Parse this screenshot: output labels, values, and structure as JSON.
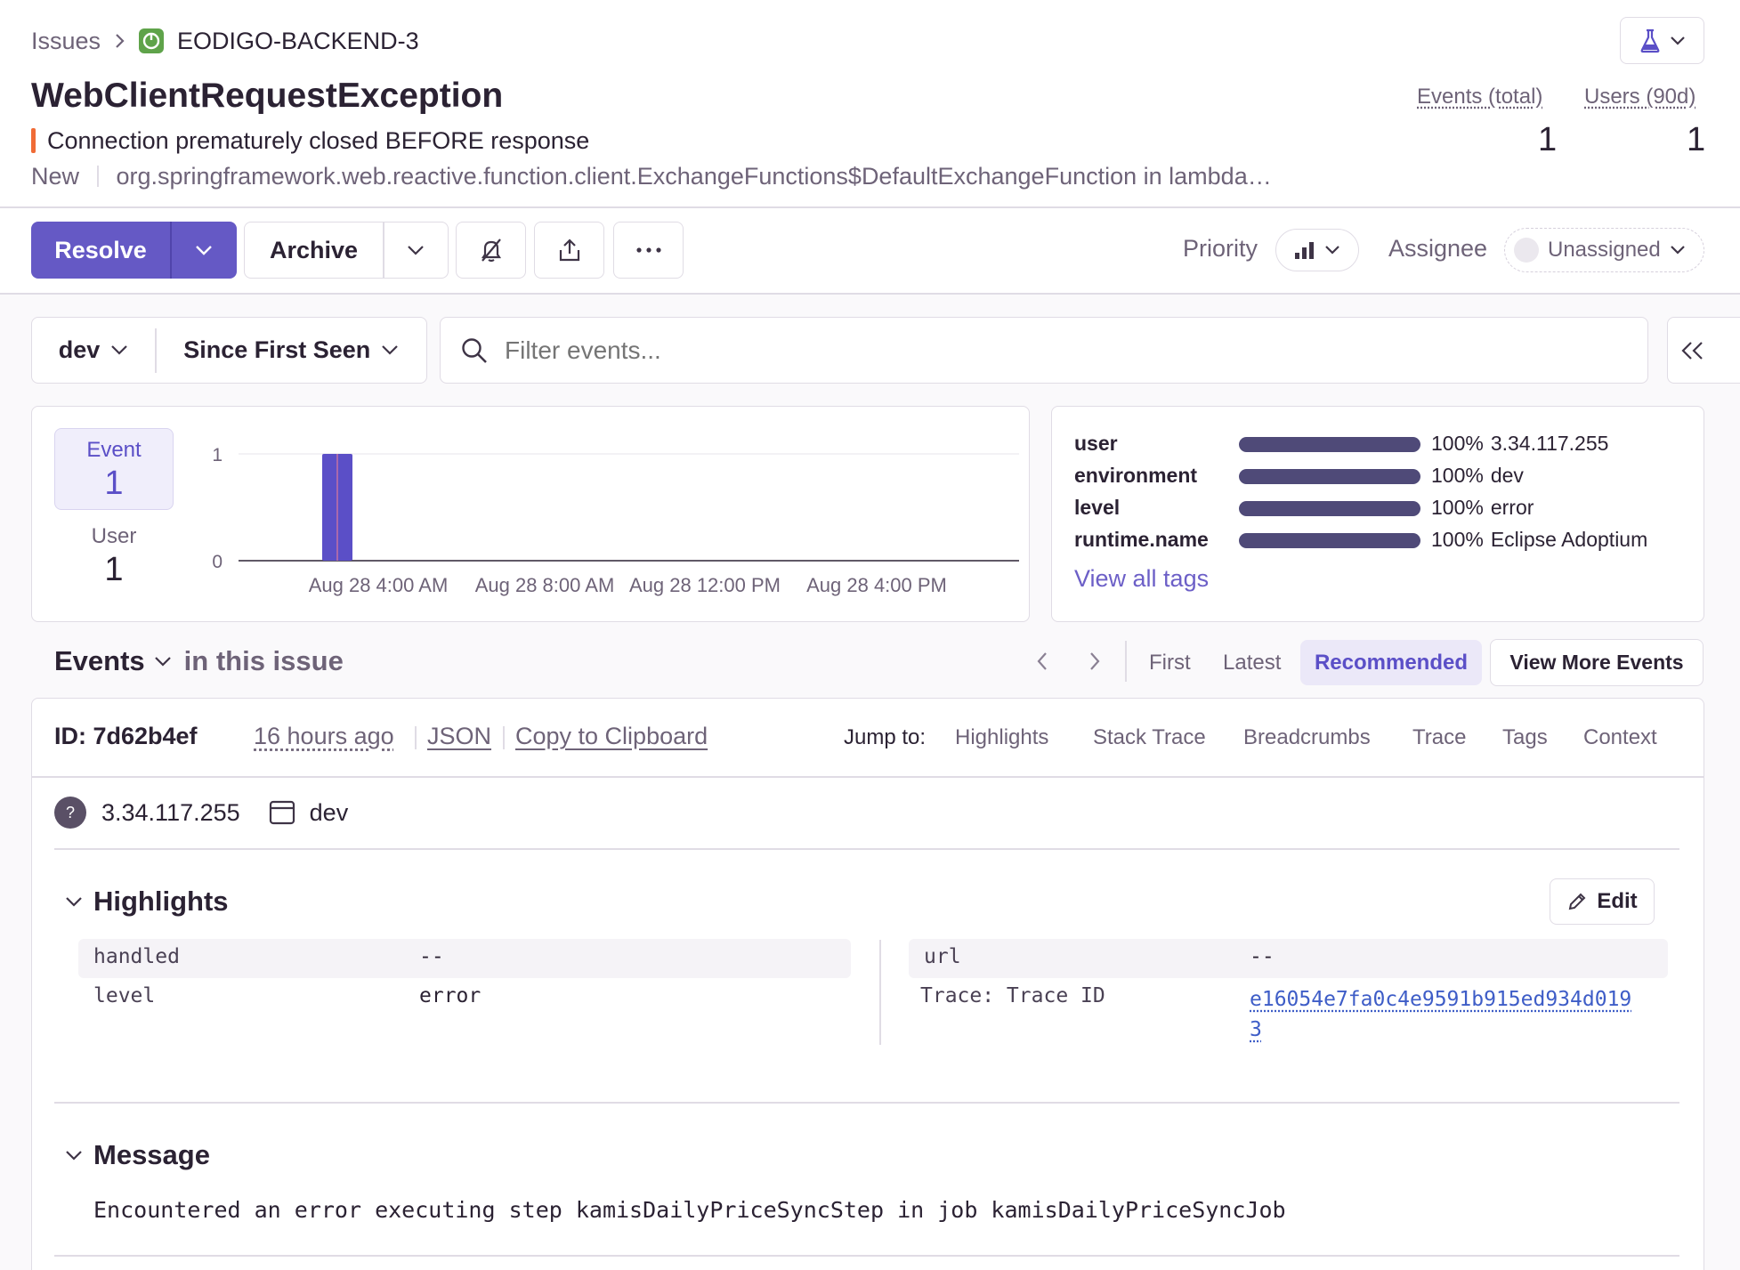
{
  "breadcrumb": {
    "issues": "Issues",
    "project": "EODIGO-BACKEND-3"
  },
  "issue": {
    "title": "WebClientRequestException",
    "message": "Connection prematurely closed BEFORE response",
    "status": "New",
    "culprit": "org.springframework.web.reactive.function.client.ExchangeFunctions$DefaultExchangeFunction in lambda…"
  },
  "stats": {
    "events_label": "Events (total)",
    "events_value": "1",
    "users_label": "Users (90d)",
    "users_value": "1"
  },
  "actions": {
    "resolve": "Resolve",
    "archive": "Archive",
    "priority_label": "Priority",
    "assignee_label": "Assignee",
    "assignee_value": "Unassigned"
  },
  "filters": {
    "environment": "dev",
    "period": "Since First Seen",
    "search_placeholder": "Filter events..."
  },
  "summary": {
    "event_label": "Event",
    "event_value": "1",
    "user_label": "User",
    "user_value": "1"
  },
  "chart_data": {
    "type": "bar",
    "y_ticks": [
      "1",
      "0"
    ],
    "ylim": [
      0,
      1
    ],
    "x_tick_labels": [
      "Aug 28 4:00 AM",
      "Aug 28 8:00 AM",
      "Aug 28 12:00 PM",
      "Aug 28 4:00 PM"
    ],
    "series": [
      {
        "values": [
          1
        ]
      }
    ],
    "bar_color": "#5b4fc7"
  },
  "tags": {
    "items": [
      {
        "key": "user",
        "percent": "100%",
        "value": "3.34.117.255"
      },
      {
        "key": "environment",
        "percent": "100%",
        "value": "dev"
      },
      {
        "key": "level",
        "percent": "100%",
        "value": "error"
      },
      {
        "key": "runtime.name",
        "percent": "100%",
        "value": "Eclipse Adoptium"
      }
    ],
    "view_all": "View all tags"
  },
  "events_header": {
    "title": "Events",
    "subtitle": "in this issue",
    "first": "First",
    "latest": "Latest",
    "recommended": "Recommended",
    "view_more": "View More Events"
  },
  "event": {
    "id": "ID: 7d62b4ef",
    "age": "16 hours ago",
    "json": "JSON",
    "copy": "Copy to Clipboard",
    "jump_label": "Jump to:",
    "jump_items": [
      "Highlights",
      "Stack Trace",
      "Breadcrumbs",
      "Trace",
      "Tags",
      "Context"
    ],
    "ip": "3.34.117.255",
    "env": "dev",
    "user_avatar": "?"
  },
  "highlights": {
    "title": "Highlights",
    "edit": "Edit",
    "left": [
      {
        "key": "handled",
        "value": "--"
      },
      {
        "key": "level",
        "value": "error"
      }
    ],
    "right": [
      {
        "key": "url",
        "value": "--"
      },
      {
        "key": "Trace: Trace ID",
        "value_line1": "e16054e7fa0c4e9591b915ed934d019",
        "value_line2": "3"
      }
    ]
  },
  "message": {
    "title": "Message",
    "text": "Encountered an error executing step kamisDailyPriceSyncStep in job kamisDailyPriceSyncJob"
  },
  "colors": {
    "accent": "#6c5fc7",
    "resolve_bg": "#6559c5",
    "bar": "#5b4fc7",
    "tag_bar": "#4f4a78",
    "error_marker": "#f06b36",
    "project_icon": "#5fa34a"
  }
}
